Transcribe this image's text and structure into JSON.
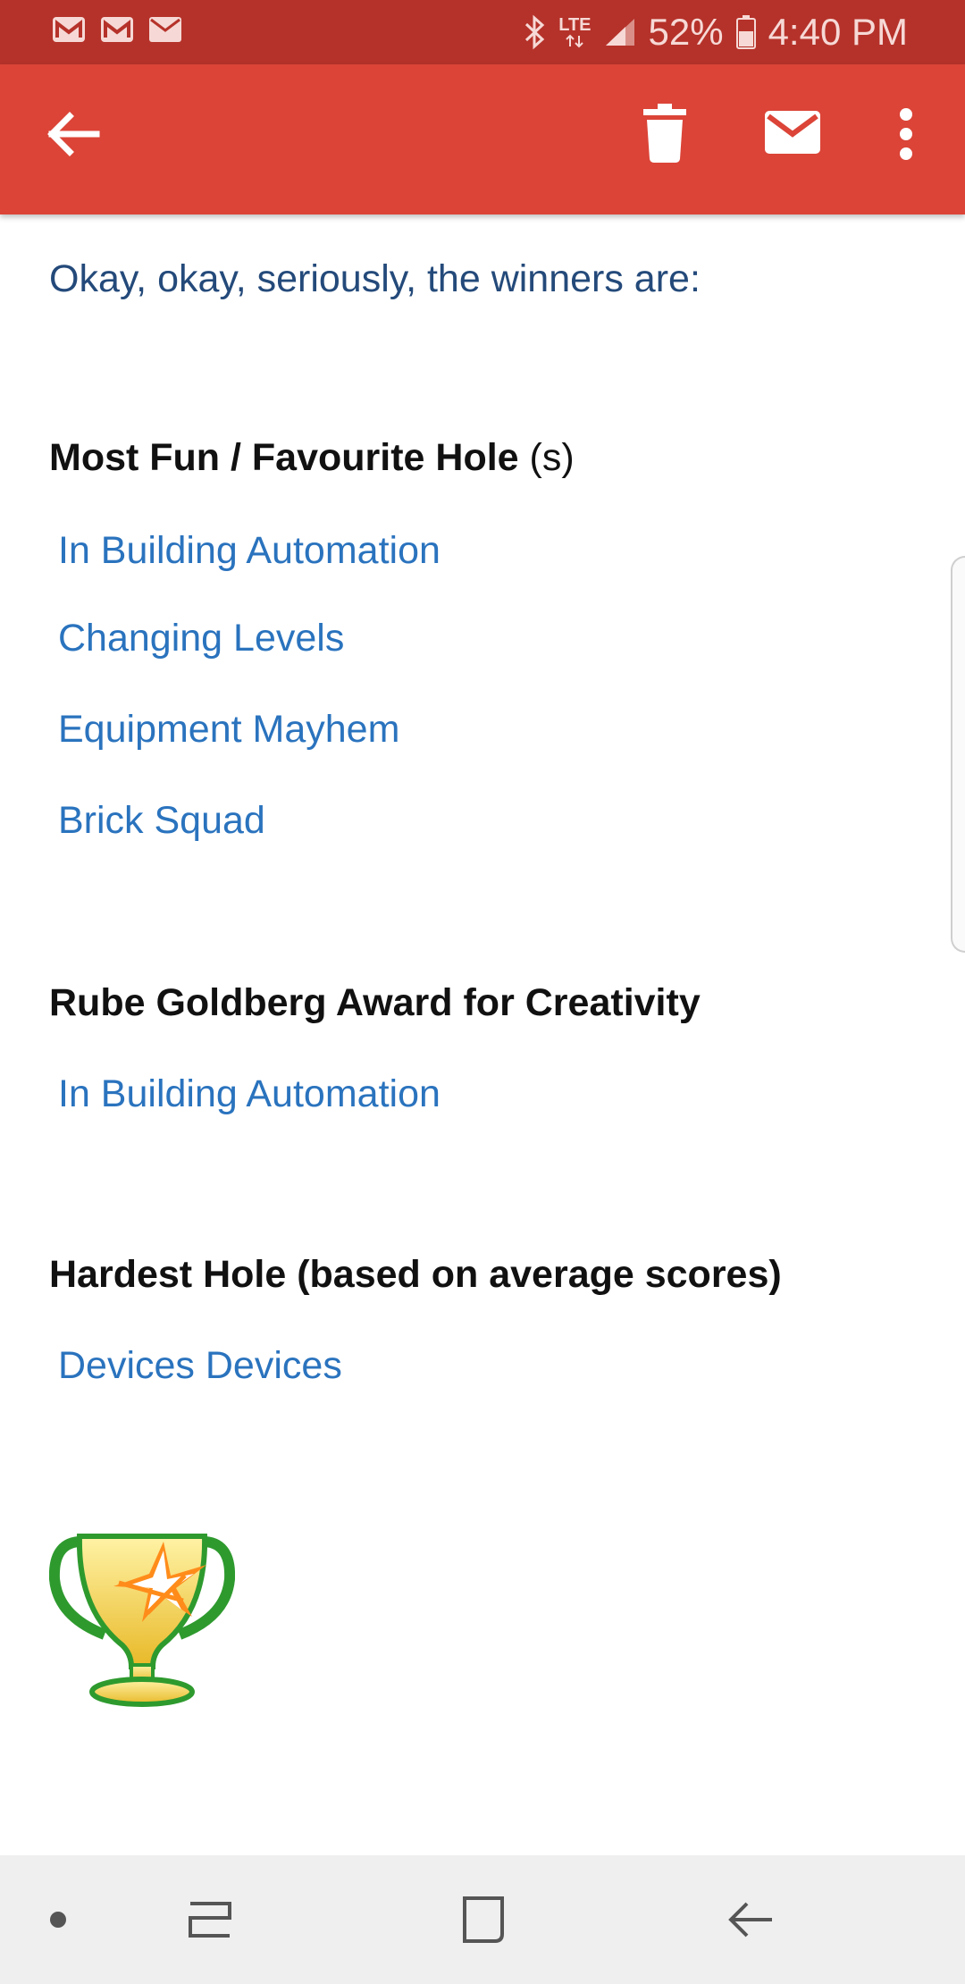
{
  "status_bar": {
    "notification_icons": [
      "gmail-icon",
      "gmail-icon",
      "email-icon"
    ],
    "lte": "LTE",
    "battery": "52%",
    "time": "4:40 PM"
  },
  "app_bar": {
    "icons": [
      "back-arrow-icon",
      "trash-icon",
      "mail-icon",
      "more-vert-icon"
    ]
  },
  "email": {
    "intro": "Okay, okay, seriously, the winners are:",
    "sections": [
      {
        "title": "Most Fun / Favourite Hole",
        "title_suffix": "(s)",
        "items": [
          "In Building Automation",
          "Changing Levels",
          "Equipment Mayhem",
          "Brick Squad"
        ]
      },
      {
        "title": "Rube Goldberg Award for Creativity",
        "items": [
          "In Building Automation"
        ]
      },
      {
        "title": "Hardest Hole (based on average scores)",
        "items": [
          "Devices Devices"
        ]
      }
    ]
  },
  "nav_bar": {
    "icons": [
      "dot-icon",
      "recents-icon",
      "home-icon",
      "back-icon"
    ]
  },
  "colors": {
    "status_bar": "#b5322a",
    "app_bar": "#db4437",
    "link": "#2a73be",
    "intro_text": "#244a7a"
  }
}
